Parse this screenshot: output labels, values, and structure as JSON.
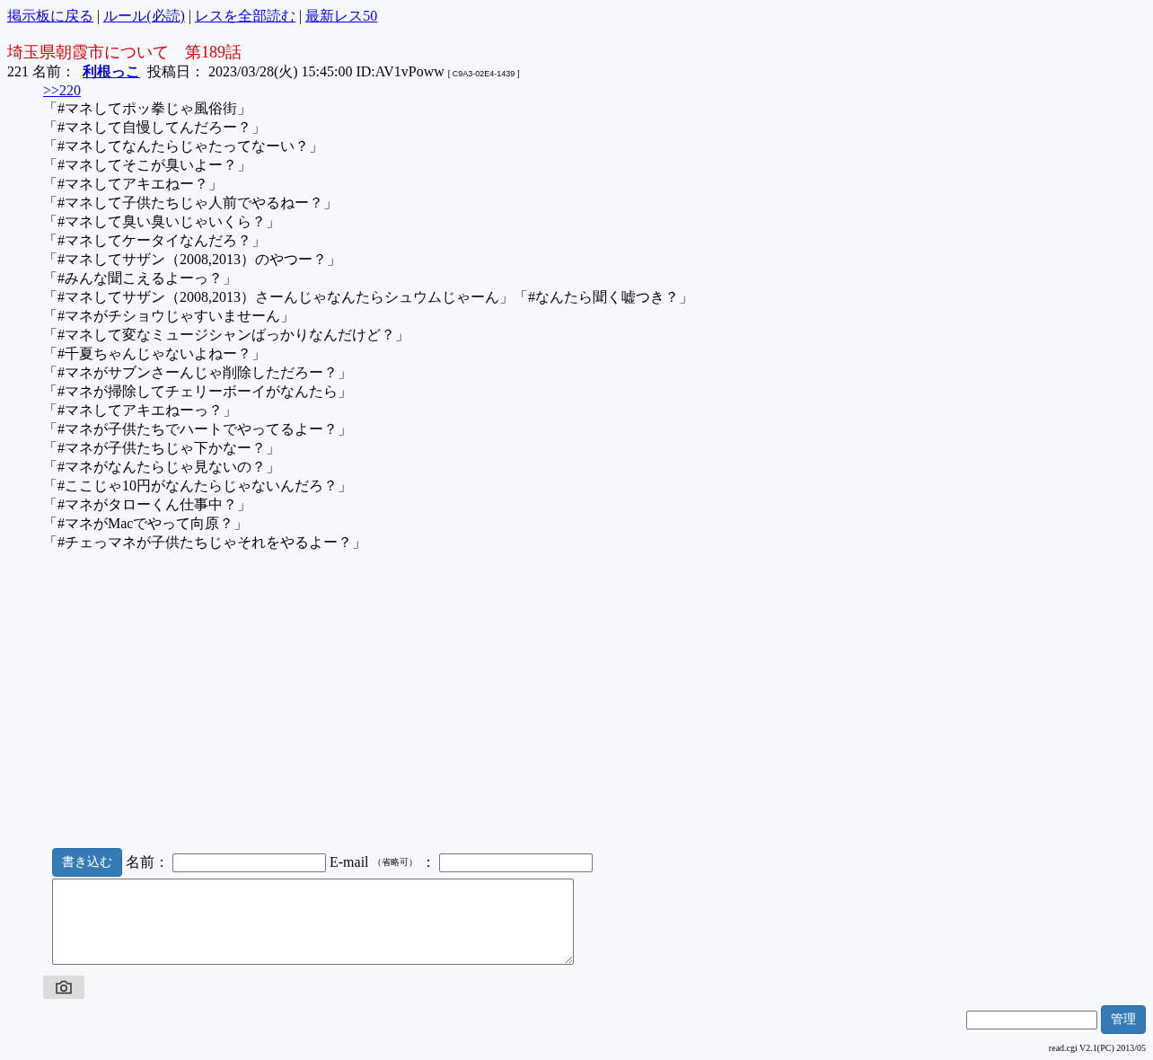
{
  "nav_links": [
    {
      "label": "掲示板に戻る"
    },
    {
      "label": "ルール(必読)"
    },
    {
      "label": "レスを全部読む"
    },
    {
      "label": "最新レス50"
    }
  ],
  "nav_separator": "|",
  "thread_title": "埼玉県朝霞市について　第189話",
  "post": {
    "number": "221",
    "name_label": "名前：",
    "name": "利根っこ",
    "date_label": "投稿日：",
    "date": "2023/03/28(火) 15:45:00",
    "id": "ID:AV1vPoww",
    "host": "[ C9A3-02E4-1439 ]",
    "reply_link": ">>220",
    "lines": [
      "「#マネしてポッ拳じゃ風俗街」",
      "「#マネして自慢してんだろー？」",
      "「#マネしてなんたらじゃたってなーい？」",
      "「#マネしてそこが臭いよー？」",
      "「#マネしてアキエねー？」",
      "「#マネして子供たちじゃ人前でやるねー？」",
      "「#マネして臭い臭いじゃいくら？」",
      "「#マネしてケータイなんだろ？」",
      "「#マネしてサザン（2008,2013）のやつー？」",
      "「#みんな聞こえるよーっ？」",
      "「#マネしてサザン（2008,2013）さーんじゃなんたらシュウムじゃーん」「#なんたら聞く嘘つき？」",
      "「#マネがチショウじゃすいませーん」",
      "「#マネして変なミュージシャンばっかりなんだけど？」",
      "「#千夏ちゃんじゃないよねー？」",
      "「#マネがサブンさーんじゃ削除しただろー？」",
      "「#マネが掃除してチェリーボーイがなんたら」",
      "「#マネしてアキエねーっ？」",
      "「#マネが子供たちでハートでやってるよー？」",
      "「#マネが子供たちじゃ下かなー？」",
      "「#マネがなんたらじゃ見ないの？」",
      "「#ここじゃ10円がなんたらじゃないんだろ？」",
      "「#マネがタローくん仕事中？」",
      "「#マネがMacでやって向原？」",
      "「#チェっマネが子供たちじゃそれをやるよー？」"
    ]
  },
  "form": {
    "submit": "書き込む",
    "name_label": "名前：",
    "email_label": "E-mail",
    "email_note": "（省略可）",
    "email_colon": "："
  },
  "admin": {
    "button": "管理"
  },
  "footer": "read.cgi V2.1(PC) 2013/05"
}
